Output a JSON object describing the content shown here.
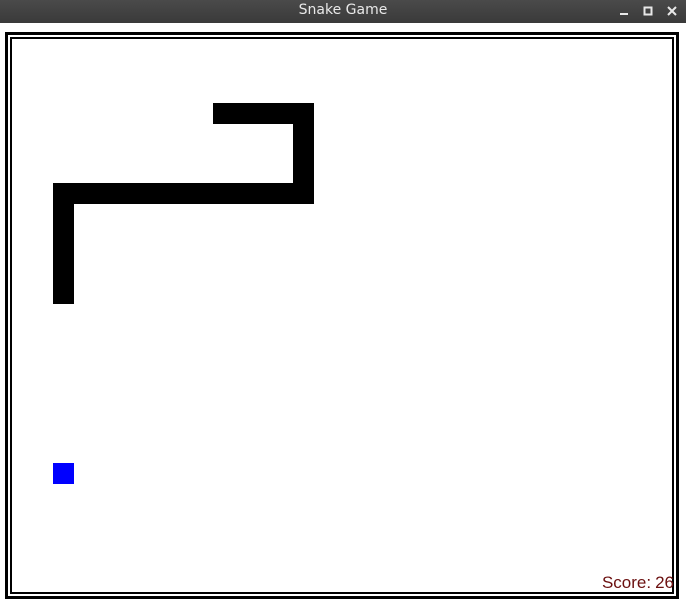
{
  "window": {
    "title": "Snake Game",
    "controls": [
      "minimize-icon",
      "maximize-icon",
      "close-icon"
    ]
  },
  "game": {
    "score_label": "Score:",
    "score": "26",
    "grid_cell": "unit",
    "snake_segments": [
      {
        "x": 10,
        "y": 3
      },
      {
        "x": 11,
        "y": 3
      },
      {
        "x": 12,
        "y": 3
      },
      {
        "x": 13,
        "y": 3
      },
      {
        "x": 14,
        "y": 3
      },
      {
        "x": 14,
        "y": 4
      },
      {
        "x": 14,
        "y": 5
      },
      {
        "x": 14,
        "y": 6
      },
      {
        "x": 14,
        "y": 7
      },
      {
        "x": 13,
        "y": 7
      },
      {
        "x": 12,
        "y": 7
      },
      {
        "x": 11,
        "y": 7
      },
      {
        "x": 10,
        "y": 7
      },
      {
        "x": 9,
        "y": 7
      },
      {
        "x": 8,
        "y": 7
      },
      {
        "x": 7,
        "y": 7
      },
      {
        "x": 6,
        "y": 7
      },
      {
        "x": 5,
        "y": 7
      },
      {
        "x": 4,
        "y": 7
      },
      {
        "x": 3,
        "y": 7
      },
      {
        "x": 2,
        "y": 7
      },
      {
        "x": 2,
        "y": 8
      },
      {
        "x": 2,
        "y": 9
      },
      {
        "x": 2,
        "y": 10
      },
      {
        "x": 2,
        "y": 11
      },
      {
        "x": 2,
        "y": 12
      }
    ],
    "food": {
      "x": 2,
      "y": 21
    },
    "colors": {
      "snake": "#000000",
      "food": "#0000ff",
      "score": "#6b0f0f",
      "background": "#ffffff"
    }
  }
}
